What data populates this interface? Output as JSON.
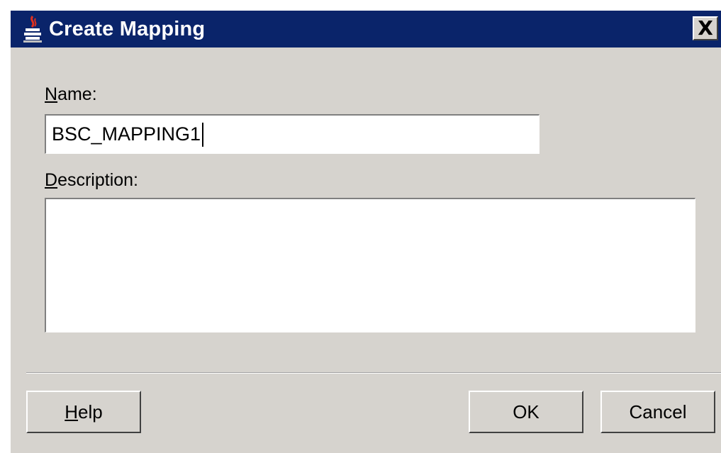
{
  "window": {
    "title": "Create Mapping",
    "close_glyph": "X",
    "icon": "java-cup-icon"
  },
  "form": {
    "name_label_mnemonic": "N",
    "name_label_rest": "ame:",
    "name_value": "BSC_MAPPING1",
    "description_label_mnemonic": "D",
    "description_label_rest": "escription:",
    "description_value": ""
  },
  "buttons": {
    "help_mnemonic": "H",
    "help_rest": "elp",
    "ok": "OK",
    "cancel": "Cancel"
  },
  "colors": {
    "titlebar": "#0a246a",
    "dialog_bg": "#d6d3ce"
  }
}
